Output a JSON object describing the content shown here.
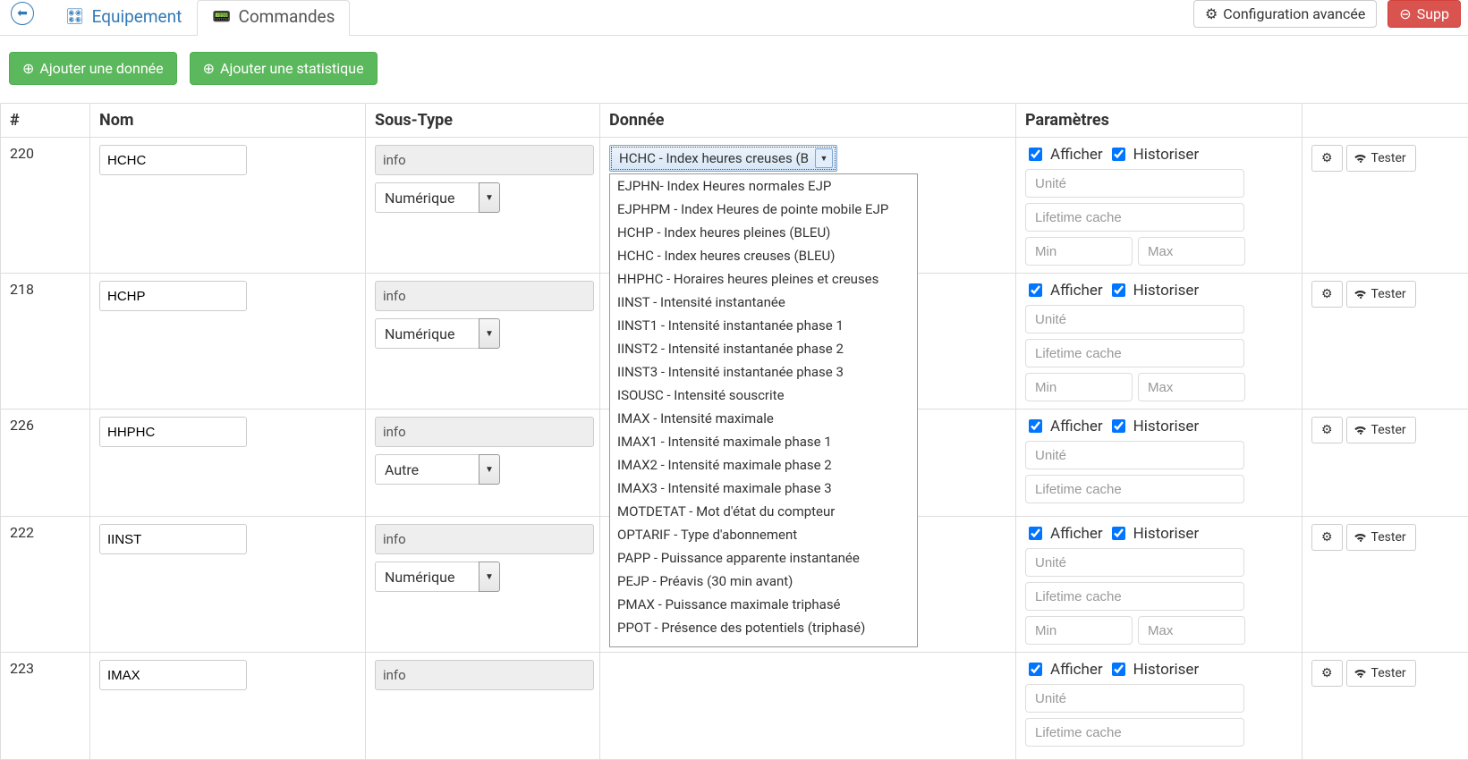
{
  "tabs": {
    "equipement": "Equipement",
    "commandes": "Commandes",
    "config_avancee": "Configuration avancée",
    "supprimer": "Supp"
  },
  "actions": {
    "add_data": "Ajouter une donnée",
    "add_stat": "Ajouter une statistique"
  },
  "headers": {
    "id": "#",
    "nom": "Nom",
    "soustype": "Sous-Type",
    "donnee": "Donnée",
    "parametres": "Paramètres"
  },
  "rows": [
    {
      "id": "220",
      "nom": "HCHC",
      "type_text": "info",
      "subtype": "Numérique",
      "donnee_selected": "HCHC - Index heures creuses (B",
      "show_dropdown": true,
      "show_minmax": true
    },
    {
      "id": "218",
      "nom": "HCHP",
      "type_text": "info",
      "subtype": "Numérique",
      "donnee_selected": "",
      "show_dropdown": false,
      "show_minmax": true
    },
    {
      "id": "226",
      "nom": "HHPHC",
      "type_text": "info",
      "subtype": "Autre",
      "donnee_selected": "",
      "show_dropdown": false,
      "show_minmax": false
    },
    {
      "id": "222",
      "nom": "IINST",
      "type_text": "info",
      "subtype": "Numérique",
      "donnee_selected": "",
      "show_dropdown": false,
      "show_minmax": true
    },
    {
      "id": "223",
      "nom": "IMAX",
      "type_text": "info",
      "subtype": "",
      "donnee_selected": "",
      "show_dropdown": false,
      "show_minmax": false
    }
  ],
  "dropdown_options": [
    "EJPHN- Index Heures normales EJP",
    "EJPHPM - Index Heures de pointe mobile EJP",
    "HCHP - Index heures pleines (BLEU)",
    "HCHC - Index heures creuses (BLEU)",
    "HHPHC - Horaires heures pleines et creuses",
    "IINST - Intensité instantanée",
    "IINST1 - Intensité instantanée phase 1",
    "IINST2 - Intensité instantanée phase 2",
    "IINST3 - Intensité instantanée phase 3",
    "ISOUSC - Intensité souscrite",
    "IMAX - Intensité maximale",
    "IMAX1 - Intensité maximale phase 1",
    "IMAX2 - Intensité maximale phase 2",
    "IMAX3 - Intensité maximale phase 3",
    "MOTDETAT - Mot d'état du compteur",
    "OPTARIF - Type d'abonnement",
    "PAPP - Puissance apparente instantanée",
    "PEJP - Préavis (30 min avant)",
    "PMAX - Puissance maximale triphasé",
    "PPOT - Présence des potentiels (triphasé)"
  ],
  "params": {
    "afficher": "Afficher",
    "historiser": "Historiser",
    "unite_ph": "Unité",
    "lifetime_ph": "Lifetime cache",
    "min_ph": "Min",
    "max_ph": "Max"
  },
  "row_actions": {
    "tester": "Tester"
  }
}
